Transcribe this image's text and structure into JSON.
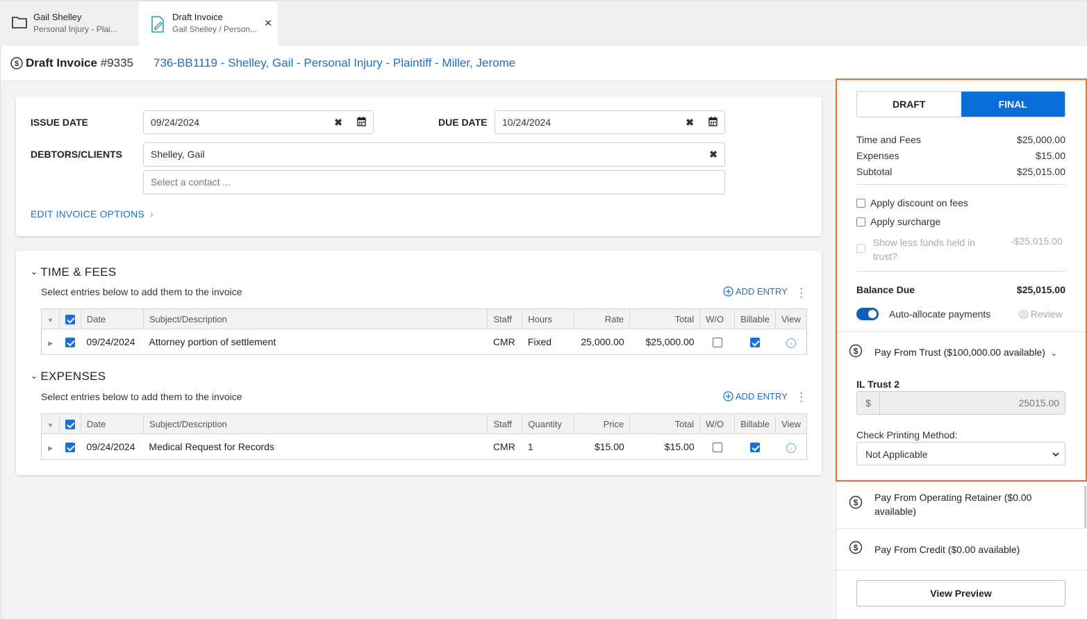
{
  "tabs": [
    {
      "title": "Gail Shelley",
      "subtitle": "Personal Injury - Plai..."
    },
    {
      "title": "Draft Invoice",
      "subtitle": "Gail Shelley / Person...",
      "close": "✕"
    }
  ],
  "header": {
    "title": "Draft Invoice",
    "number": "#9335",
    "matter": "736-BB1119 - Shelley, Gail - Personal Injury - Plaintiff - Miller, Jerome"
  },
  "invoice_form": {
    "issue_date_label": "ISSUE DATE",
    "issue_date": "09/24/2024",
    "due_date_label": "DUE DATE",
    "due_date": "10/24/2024",
    "debtors_label": "DEBTORS/CLIENTS",
    "debtor": "Shelley, Gail",
    "contact_placeholder": "Select a contact ...",
    "edit_options": "EDIT INVOICE OPTIONS"
  },
  "time_fees": {
    "heading": "TIME & FEES",
    "instructions": "Select entries below to add them to the invoice",
    "add_entry": "ADD ENTRY",
    "columns": [
      "Date",
      "Subject/Description",
      "Staff",
      "Hours",
      "Rate",
      "Total",
      "W/O",
      "Billable",
      "View"
    ],
    "rows": [
      {
        "date": "09/24/2024",
        "description": "Attorney portion of settlement",
        "staff": "CMR",
        "hours": "Fixed",
        "rate": "25,000.00",
        "total": "$25,000.00",
        "wo": false,
        "billable": true
      }
    ]
  },
  "expenses": {
    "heading": "EXPENSES",
    "instructions": "Select entries below to add them to the invoice",
    "add_entry": "ADD ENTRY",
    "columns": [
      "Date",
      "Subject/Description",
      "Staff",
      "Quantity",
      "Price",
      "Total",
      "W/O",
      "Billable",
      "View"
    ],
    "rows": [
      {
        "date": "09/24/2024",
        "description": "Medical Request for Records",
        "staff": "CMR",
        "quantity": "1",
        "price": "$15.00",
        "total": "$15.00",
        "wo": false,
        "billable": true
      }
    ]
  },
  "summary": {
    "mode_draft": "DRAFT",
    "mode_final": "FINAL",
    "time_fees_label": "Time and Fees",
    "time_fees_value": "$25,000.00",
    "expenses_label": "Expenses",
    "expenses_value": "$15.00",
    "subtotal_label": "Subtotal",
    "subtotal_value": "$25,015.00",
    "discount_label": "Apply discount on fees",
    "surcharge_label": "Apply surcharge",
    "trust_label_1": "Show less funds held in",
    "trust_label_2": "trust?",
    "trust_value": "-$25,015.00",
    "balance_label": "Balance Due",
    "balance_value": "$25,015.00",
    "auto_allocate_label": "Auto-allocate payments",
    "review_label": "Review"
  },
  "payments": {
    "trust_label": "Pay From Trust ($100,000.00 available)",
    "trust_account": "IL Trust 2",
    "currency_symbol": "$",
    "trust_amount": "25015.00",
    "check_method_label": "Check Printing Method:",
    "check_method_value": "Not Applicable",
    "operating_label_1": "Pay From Operating Retainer ($0.00",
    "operating_label_2": "available)",
    "credit_label": "Pay From Credit ($0.00 available)",
    "preview_button": "View Preview"
  },
  "colors": {
    "accent": "#0a6ed8",
    "link": "#1f6fbf",
    "highlight": "#e8722a"
  }
}
